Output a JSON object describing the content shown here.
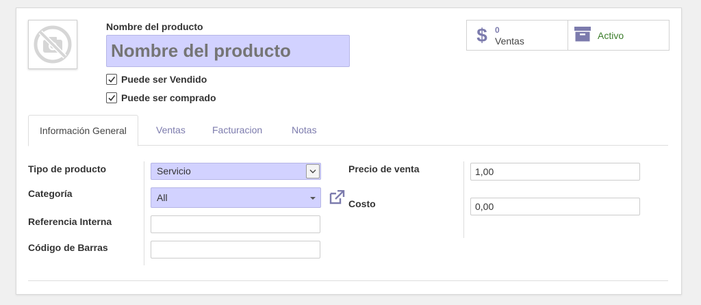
{
  "product": {
    "name_label": "Nombre del producto",
    "name_placeholder": "Nombre del producto",
    "can_be_sold_label": "Puede ser Vendido",
    "can_be_sold": true,
    "can_be_purchased_label": "Puede ser comprado",
    "can_be_purchased": true,
    "image_icon": "camera-no-image-icon"
  },
  "smart_buttons": {
    "sales": {
      "count": "0",
      "label": "Ventas",
      "icon": "dollar-icon"
    },
    "active": {
      "label": "Activo",
      "icon": "archive-icon"
    }
  },
  "tabs": [
    {
      "label": "Información General",
      "active": true
    },
    {
      "label": "Ventas",
      "active": false
    },
    {
      "label": "Facturacion",
      "active": false
    },
    {
      "label": "Notas",
      "active": false
    }
  ],
  "form": {
    "product_type_label": "Tipo de producto",
    "product_type_value": "Servicio",
    "category_label": "Categoría",
    "category_value": "All",
    "internal_ref_label": "Referencia Interna",
    "internal_ref_value": "",
    "barcode_label": "Código de Barras",
    "barcode_value": "",
    "sale_price_label": "Precio de venta",
    "sale_price_value": "1,00",
    "cost_label": "Costo",
    "cost_value": "0,00"
  },
  "colors": {
    "accent": "#7c7bad",
    "input_highlight": "#d2d2ff",
    "active_green": "#3b7d2a"
  }
}
